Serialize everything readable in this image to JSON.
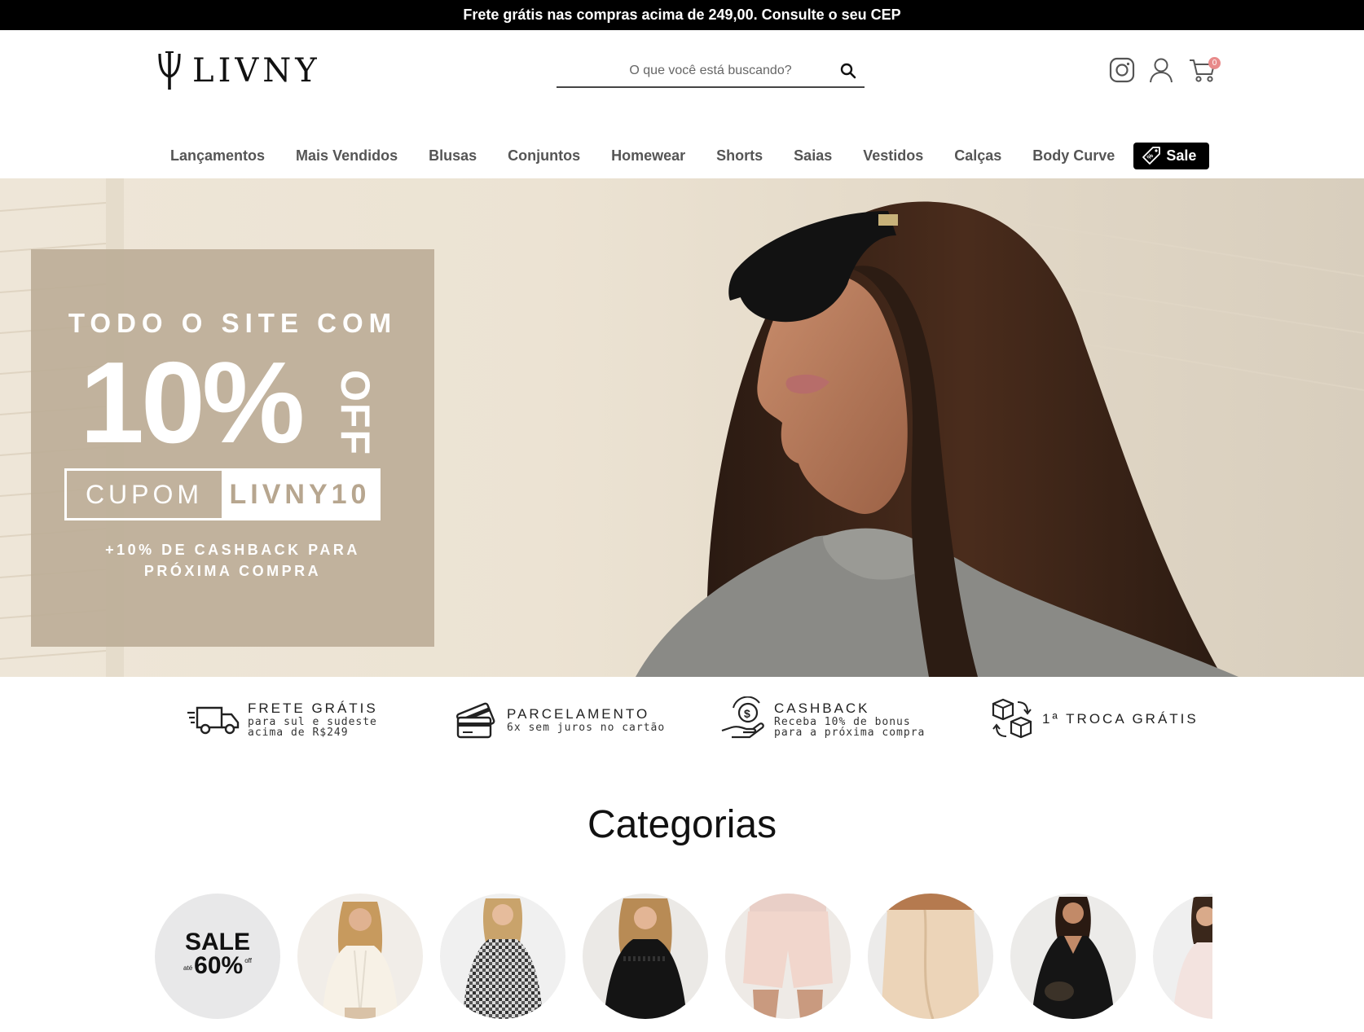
{
  "promo_bar": {
    "text": "Frete grátis nas compras acima de 249,00. Consulte o seu CEP"
  },
  "header": {
    "logo_text": "LIVNY",
    "search_placeholder": "O que você está buscando?",
    "cart_count": "0"
  },
  "nav": {
    "items": [
      "Lançamentos",
      "Mais Vendidos",
      "Blusas",
      "Conjuntos",
      "Homewear",
      "Shorts",
      "Saias",
      "Vestidos",
      "Calças",
      "Body Curve"
    ],
    "sale_label": "Sale"
  },
  "hero": {
    "line1": "TODO O SITE COM",
    "big": "10%",
    "off": "OFF",
    "coupon_label": "CUPOM",
    "coupon_code": "LIVNY10",
    "cashback": "+10% DE CASHBACK PARA PRÓXIMA COMPRA"
  },
  "benefits": [
    {
      "icon": "truck-icon",
      "title": "FRETE GRÁTIS",
      "sub1": "para sul e sudeste",
      "sub2": "acima de R$249"
    },
    {
      "icon": "credit-card-icon",
      "title": "PARCELAMENTO",
      "sub1": "6x sem juros no cartão",
      "sub2": ""
    },
    {
      "icon": "cashback-hand-icon",
      "title": "CASHBACK",
      "sub1": "Receba 10% de bonus",
      "sub2": "para a próxima compra"
    },
    {
      "icon": "exchange-boxes-icon",
      "title": "1ª TROCA GRÁTIS",
      "sub1": "",
      "sub2": ""
    }
  ],
  "categories": {
    "title": "Categorias",
    "sale_badge": {
      "line1": "SALE",
      "prefix": "até",
      "value": "60%",
      "suffix": "off"
    }
  },
  "colors": {
    "accent_black": "#000000",
    "promo_beige": "#bdae98",
    "cart_badge": "#e88a8a"
  }
}
